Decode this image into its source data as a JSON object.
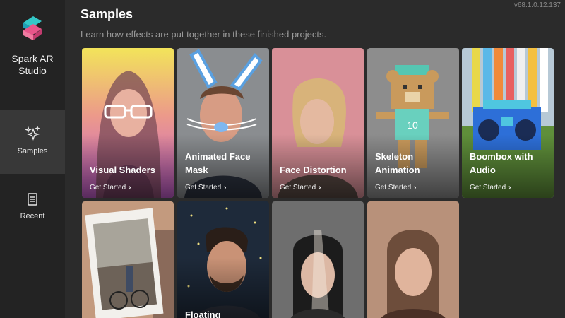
{
  "app": {
    "name_line1": "Spark AR",
    "name_line2": "Studio",
    "version": "v68.1.0.12.137"
  },
  "sidebar": {
    "items": [
      {
        "label": "Samples",
        "icon": "sparkles-icon",
        "active": true
      },
      {
        "label": "Recent",
        "icon": "document-icon",
        "active": false
      }
    ]
  },
  "header": {
    "title": "Samples",
    "subtitle": "Learn how effects are put together in these finished projects."
  },
  "cards": [
    {
      "title": "Visual Shaders",
      "cta": "Get Started"
    },
    {
      "title": "Animated Face Mask",
      "cta": "Get Started"
    },
    {
      "title": "Face Distortion",
      "cta": "Get Started"
    },
    {
      "title": "Skeleton Animation",
      "cta": "Get Started"
    },
    {
      "title": "Boombox with Audio",
      "cta": "Get Started"
    },
    {
      "title": "",
      "cta": ""
    },
    {
      "title": "Floating",
      "cta": ""
    },
    {
      "title": "",
      "cta": ""
    },
    {
      "title": "",
      "cta": ""
    }
  ],
  "colors": {
    "background": "#2b2b2b",
    "sidebar": "#232323",
    "sidebar_active": "#383838",
    "brand_teal": "#2ec4c4",
    "brand_pink": "#f0507a"
  }
}
